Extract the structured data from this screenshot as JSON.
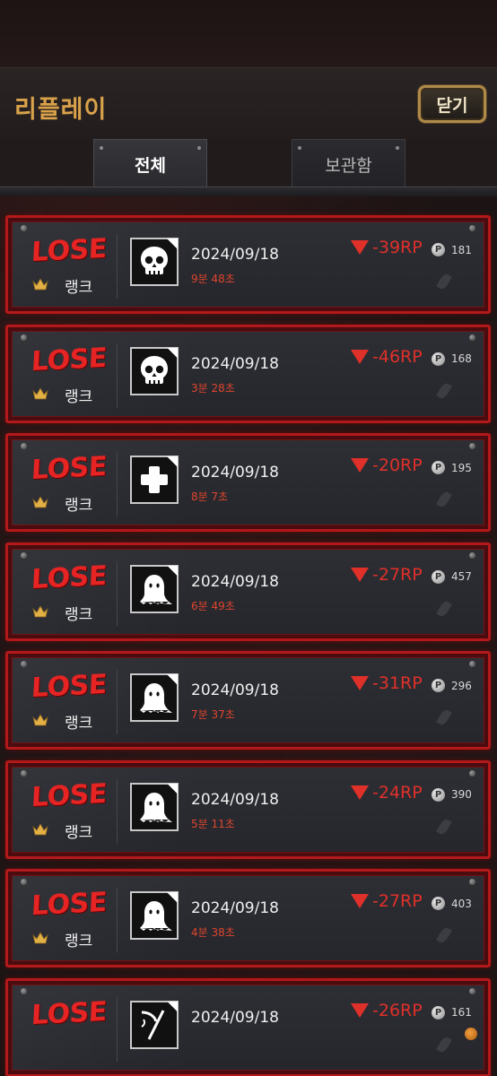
{
  "header": {
    "title": "리플레이",
    "close_label": "닫기"
  },
  "tabs": [
    {
      "label": "전체",
      "active": true
    },
    {
      "label": "보관함",
      "active": false
    }
  ],
  "colors": {
    "accent_gold": "#d9a24a",
    "lose_red": "#e62424",
    "card_border": "#b3191b"
  },
  "replays": [
    {
      "result": "LOSE",
      "rank_label": "랭크",
      "mode_icon": "skull-icon",
      "date": "2024/09/18",
      "duration": "9분 48초",
      "rp": "-39RP",
      "points": "181"
    },
    {
      "result": "LOSE",
      "rank_label": "랭크",
      "mode_icon": "skull-icon",
      "date": "2024/09/18",
      "duration": "3분 28초",
      "rp": "-46RP",
      "points": "168"
    },
    {
      "result": "LOSE",
      "rank_label": "랭크",
      "mode_icon": "medic-cross-icon",
      "date": "2024/09/18",
      "duration": "8분 7초",
      "rp": "-20RP",
      "points": "195"
    },
    {
      "result": "LOSE",
      "rank_label": "랭크",
      "mode_icon": "ghost-icon",
      "date": "2024/09/18",
      "duration": "6분 49초",
      "rp": "-27RP",
      "points": "457"
    },
    {
      "result": "LOSE",
      "rank_label": "랭크",
      "mode_icon": "ghost-icon",
      "date": "2024/09/18",
      "duration": "7분 37초",
      "rp": "-31RP",
      "points": "296"
    },
    {
      "result": "LOSE",
      "rank_label": "랭크",
      "mode_icon": "ghost-icon",
      "date": "2024/09/18",
      "duration": "5분 11초",
      "rp": "-24RP",
      "points": "390"
    },
    {
      "result": "LOSE",
      "rank_label": "랭크",
      "mode_icon": "ghost-icon",
      "date": "2024/09/18",
      "duration": "4분 38초",
      "rp": "-27RP",
      "points": "403"
    },
    {
      "result": "LOSE",
      "rank_label": "",
      "mode_icon": "scythe-icon",
      "date": "2024/09/18",
      "duration": "",
      "rp": "-26RP",
      "points": "161"
    }
  ]
}
